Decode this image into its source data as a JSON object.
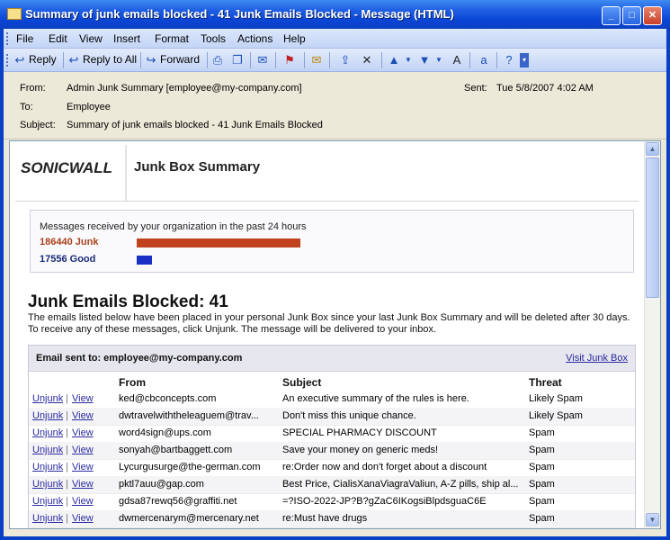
{
  "window": {
    "title": "Summary of junk emails blocked - 41 Junk Emails Blocked - Message (HTML)",
    "controls": {
      "minimize": "_",
      "maximize": "□",
      "close": "✕"
    }
  },
  "menu": [
    "File",
    "Edit",
    "View",
    "Insert",
    "Format",
    "Tools",
    "Actions",
    "Help"
  ],
  "toolbar": {
    "reply": "Reply",
    "reply_all": "Reply to All",
    "forward": "Forward"
  },
  "headers": {
    "from_label": "From:",
    "from_value": "Admin Junk Summary [employee@my-company.com]",
    "to_label": "To:",
    "to_value": "Employee",
    "subject_label": "Subject:",
    "subject_value": "Summary of junk emails blocked - 41 Junk Emails Blocked",
    "sent_label": "Sent:",
    "sent_value": "Tue 5/8/2007 4:02 AM"
  },
  "summary": {
    "logo_text": "SONICWALL",
    "title": "Junk Box Summary",
    "stats_caption": "Messages received by your organization in the past 24 hours",
    "junk_label": "186440 Junk",
    "good_label": "17556 Good",
    "junk_count": 186440,
    "good_count": 17556,
    "junk_color": "#c0421e",
    "good_color": "#1a2fc4"
  },
  "blocked": {
    "title": "Junk Emails Blocked: 41",
    "desc_line1": "The emails listed below have been placed in your personal Junk Box since your last Junk Box Summary and will be deleted after 30 days.",
    "desc_line2": "To receive any of these messages, click Unjunk. The message will be delivered to your inbox.",
    "sent_to": "Email sent to: employee@my-company.com",
    "visit_link": "Visit Junk Box",
    "columns": {
      "from": "From",
      "subject": "Subject",
      "threat": "Threat"
    },
    "actions": {
      "unjunk": "Unjunk",
      "separator": "|",
      "view": "View"
    },
    "rows": [
      {
        "from": "ked@cbconcepts.com",
        "subject": "An executive summary of the rules is here.",
        "threat": "Likely Spam"
      },
      {
        "from": "dwtravelwiththeleaguem@trav...",
        "subject": "Don't miss this unique chance.",
        "threat": "Likely Spam"
      },
      {
        "from": "word4sign@ups.com",
        "subject": "SPECIAL PHARMACY DISCOUNT",
        "threat": "Spam"
      },
      {
        "from": "sonyah@bartbaggett.com",
        "subject": "Save your money on generic meds!",
        "threat": "Spam"
      },
      {
        "from": "Lycurgusurge@the-german.com",
        "subject": "re:Order now and don't forget about a discount",
        "threat": "Spam"
      },
      {
        "from": "pktl7auu@gap.com",
        "subject": "Best Price, CialisXanaViagraValiun, A-Z pills, ship al...",
        "threat": "Spam"
      },
      {
        "from": "gdsa87rewq56@graffiti.net",
        "subject": "=?ISO-2022-JP?B?gZaC6IKogsiBlpdsguaC6E",
        "threat": "Spam"
      },
      {
        "from": "dwmercenarym@mercenary.net",
        "subject": "re:Must have drugs",
        "threat": "Spam"
      }
    ]
  }
}
